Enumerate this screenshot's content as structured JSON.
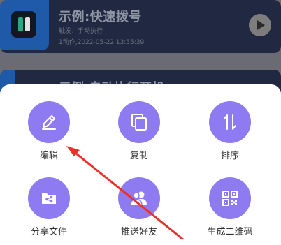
{
  "background_list": {
    "card1": {
      "title": "示例:快速拨号",
      "trigger": "触发：手动执行",
      "meta": "1动作,2022-05-22 13:55:39"
    },
    "card2": {
      "title": "示例:自动执行开机"
    }
  },
  "action_sheet": {
    "actions": [
      {
        "label": "编辑",
        "icon": "pencil-icon"
      },
      {
        "label": "复制",
        "icon": "copy-icon"
      },
      {
        "label": "排序",
        "icon": "sort-arrows-icon"
      },
      {
        "label": "分享文件",
        "icon": "share-file-icon"
      },
      {
        "label": "推送好友",
        "icon": "contacts-icon"
      },
      {
        "label": "生成二维码",
        "icon": "qr-code-icon"
      }
    ]
  },
  "colors": {
    "accent": "#8e7bf2",
    "annotation": "#e8312a",
    "overlay": "#6b6b73"
  }
}
